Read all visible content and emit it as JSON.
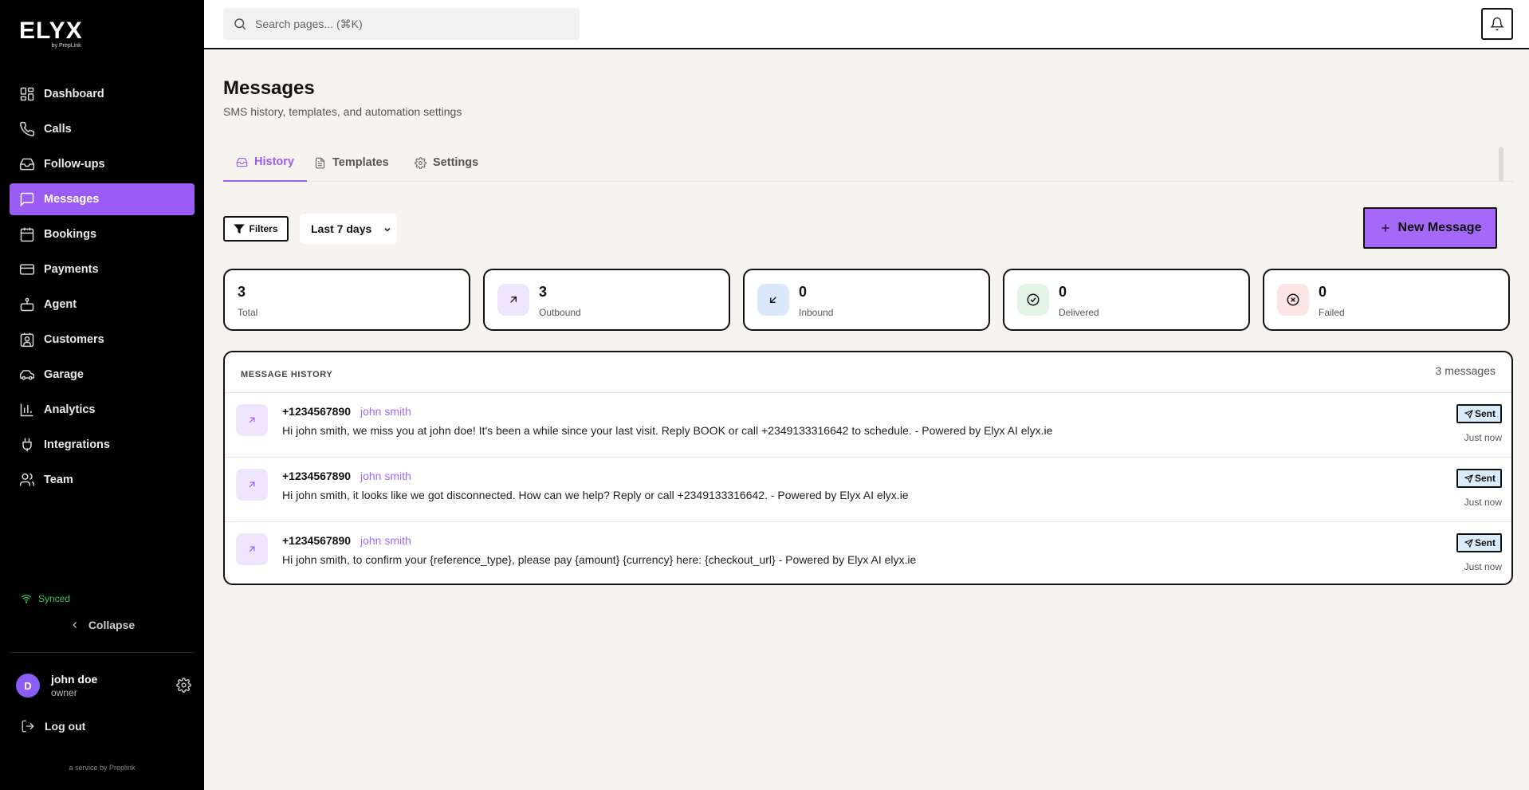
{
  "app": {
    "logo": "ELYX",
    "logo_sub": "by PrepLink",
    "service": "a service by Preplink"
  },
  "sidebar": {
    "items": [
      {
        "label": "Dashboard",
        "icon": "dashboard-icon"
      },
      {
        "label": "Calls",
        "icon": "phone-icon"
      },
      {
        "label": "Follow-ups",
        "icon": "inbox-icon"
      },
      {
        "label": "Messages",
        "icon": "message-icon",
        "active": true
      },
      {
        "label": "Bookings",
        "icon": "calendar-icon"
      },
      {
        "label": "Payments",
        "icon": "credit-card-icon"
      },
      {
        "label": "Agent",
        "icon": "bot-icon"
      },
      {
        "label": "Customers",
        "icon": "contact-icon"
      },
      {
        "label": "Garage",
        "icon": "car-icon"
      },
      {
        "label": "Analytics",
        "icon": "bar-chart-icon"
      },
      {
        "label": "Integrations",
        "icon": "plug-icon"
      },
      {
        "label": "Team",
        "icon": "users-icon"
      }
    ],
    "synced": "Synced",
    "collapse": "Collapse",
    "user": {
      "initial": "D",
      "name": "john doe",
      "role": "owner"
    },
    "logout": "Log out"
  },
  "topbar": {
    "search_placeholder": "Search pages... (⌘K)"
  },
  "page": {
    "title": "Messages",
    "subtitle": "SMS history, templates, and automation settings",
    "tabs": [
      {
        "label": "History",
        "icon": "inbox-icon",
        "active": true
      },
      {
        "label": "Templates",
        "icon": "file-text-icon"
      },
      {
        "label": "Settings",
        "icon": "gear-icon"
      }
    ],
    "filters_label": "Filters",
    "range_selected": "Last 7 days",
    "new_message_label": "New Message"
  },
  "stats": [
    {
      "value": "3",
      "label": "Total"
    },
    {
      "value": "3",
      "label": "Outbound",
      "icon": "arrow-up-right-icon",
      "bg": "#efe6fd"
    },
    {
      "value": "0",
      "label": "Inbound",
      "icon": "arrow-down-left-icon",
      "bg": "#dbe8fb"
    },
    {
      "value": "0",
      "label": "Delivered",
      "icon": "check-circle-icon",
      "bg": "#e3f6e6"
    },
    {
      "value": "0",
      "label": "Failed",
      "icon": "x-circle-icon",
      "bg": "#fbe5e5"
    }
  ],
  "history": {
    "heading": "MESSAGE HISTORY",
    "count": "3 messages",
    "rows": [
      {
        "phone": "+1234567890",
        "name": "john smith",
        "text": "Hi john smith, we miss you at john doe! It's been a while since your last visit. Reply BOOK or call +2349133316642 to schedule. - Powered by Elyx AI elyx.ie",
        "status": "Sent",
        "time": "Just now"
      },
      {
        "phone": "+1234567890",
        "name": "john smith",
        "text": "Hi john smith, it looks like we got disconnected. How can we help? Reply or call +2349133316642. - Powered by Elyx AI elyx.ie",
        "status": "Sent",
        "time": "Just now"
      },
      {
        "phone": "+1234567890",
        "name": "john smith",
        "text": "Hi john smith, to confirm your {reference_type}, please pay {amount} {currency} here: {checkout_url} - Powered by Elyx AI elyx.ie",
        "status": "Sent",
        "time": "Just now"
      }
    ]
  },
  "colors": {
    "accent": "#9a5cf5",
    "sidebar_bg": "#000000",
    "page_bg": "#f7f3ee",
    "synced": "#35c55c"
  }
}
